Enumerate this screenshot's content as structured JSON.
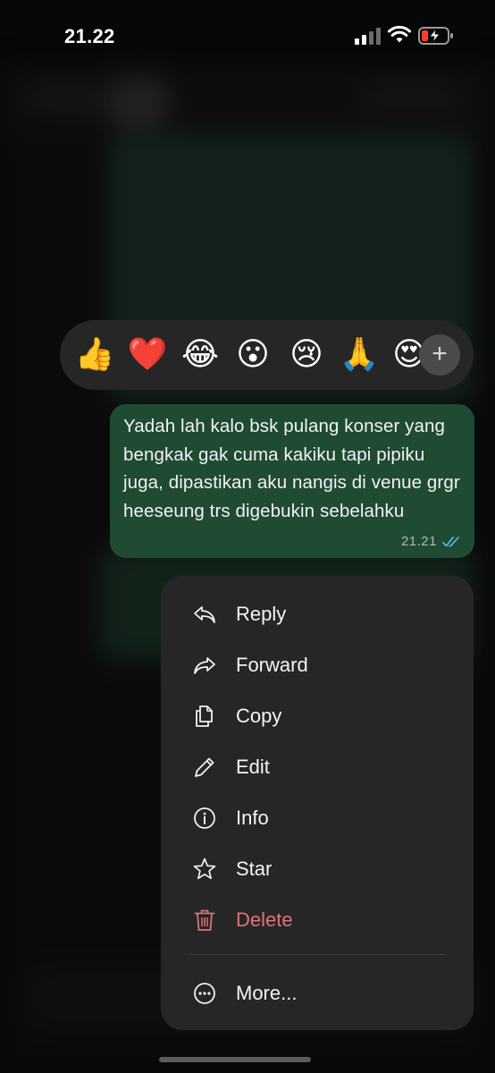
{
  "status_bar": {
    "time": "21.22"
  },
  "reactions": [
    "👍",
    "❤️",
    "😂",
    "😮",
    "😢",
    "🙏",
    "😍"
  ],
  "reaction_more": "+",
  "message": {
    "text": "Yadah lah kalo bsk pulang konser yang bengkak gak cuma kakiku tapi pipiku juga, dipastikan aku nangis di venue grgr heeseung trs digebukin sebelahku",
    "time": "21.21",
    "read_color": "#53bdeb"
  },
  "menu": {
    "items": [
      {
        "label": "Reply",
        "icon": "reply-icon"
      },
      {
        "label": "Forward",
        "icon": "forward-icon"
      },
      {
        "label": "Copy",
        "icon": "copy-icon"
      },
      {
        "label": "Edit",
        "icon": "pencil-icon"
      },
      {
        "label": "Info",
        "icon": "info-icon"
      },
      {
        "label": "Star",
        "icon": "star-icon"
      },
      {
        "label": "Delete",
        "icon": "trash-icon",
        "color": "#e0707a"
      }
    ],
    "more": {
      "label": "More...",
      "icon": "more-icon"
    }
  }
}
